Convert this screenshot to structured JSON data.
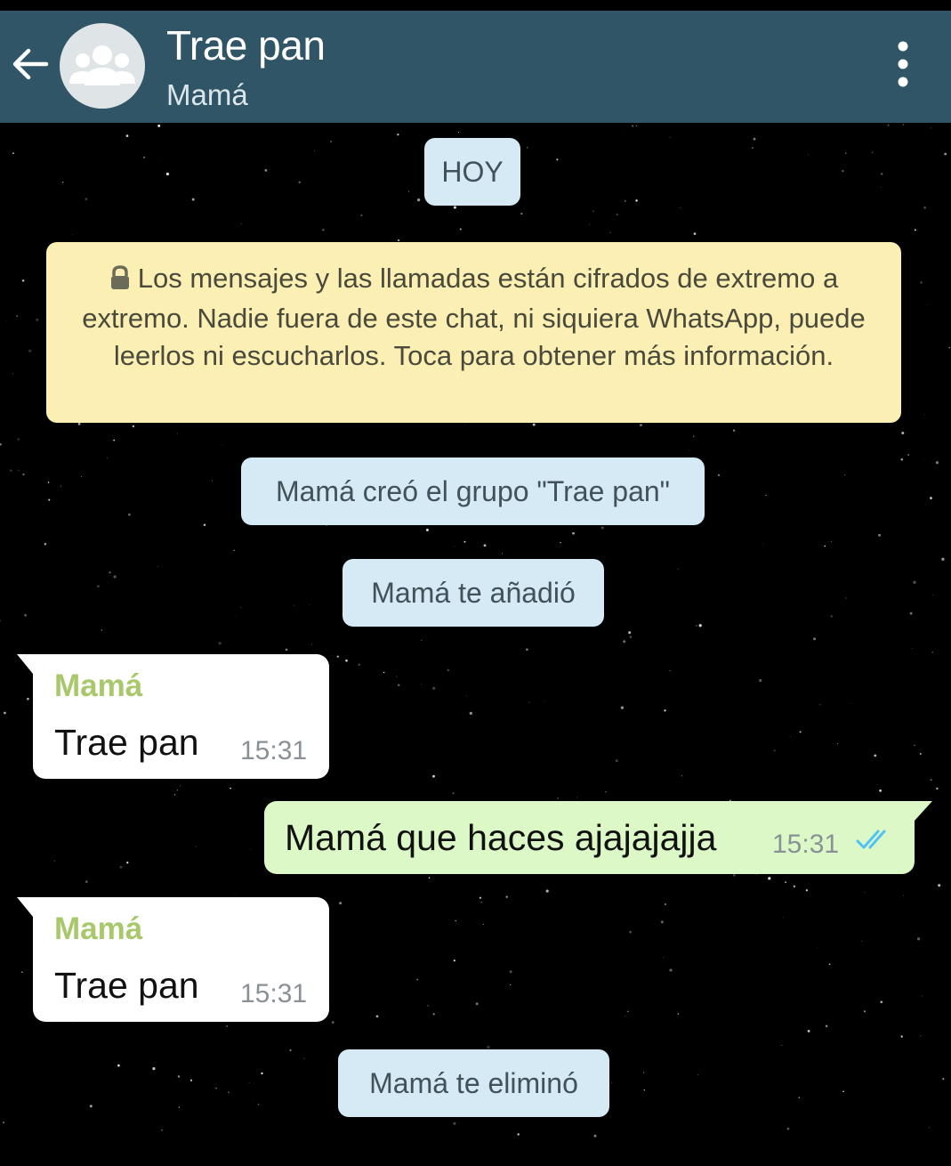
{
  "header": {
    "title": "Trae pan",
    "subtitle": "Mamá"
  },
  "icons": {
    "back": "arrow-left-icon",
    "avatar": "group-icon",
    "menu": "more-vertical-icon",
    "lock": "lock-icon",
    "read": "double-check-icon"
  },
  "colors": {
    "header_bg": "#2f5566",
    "system_bubble": "#d5eaf4",
    "encryption_bubble": "#fcefb4",
    "incoming_bubble": "#ffffff",
    "outgoing_bubble": "#dcf8c6",
    "sender_name": "#a8c86b",
    "read_ticks": "#4fc3f7"
  },
  "chat": {
    "date_label": "HOY",
    "encryption_notice": "Los mensajes y las llamadas están cifrados de extremo a extremo. Nadie fuera de este chat, ni siquiera WhatsApp, puede leerlos ni escucharlos. Toca para obtener más información.",
    "events": {
      "group_created": "Mamá creó el grupo \"Trae pan\"",
      "added_you": "Mamá te añadió",
      "removed_you": "Mamá te eliminó"
    },
    "messages": [
      {
        "sender": "Mamá",
        "text": "Trae pan",
        "time": "15:31"
      },
      {
        "text": "Mamá que haces ajajajajja",
        "time": "15:31"
      },
      {
        "sender": "Mamá",
        "text": "Trae pan",
        "time": "15:31"
      }
    ]
  }
}
